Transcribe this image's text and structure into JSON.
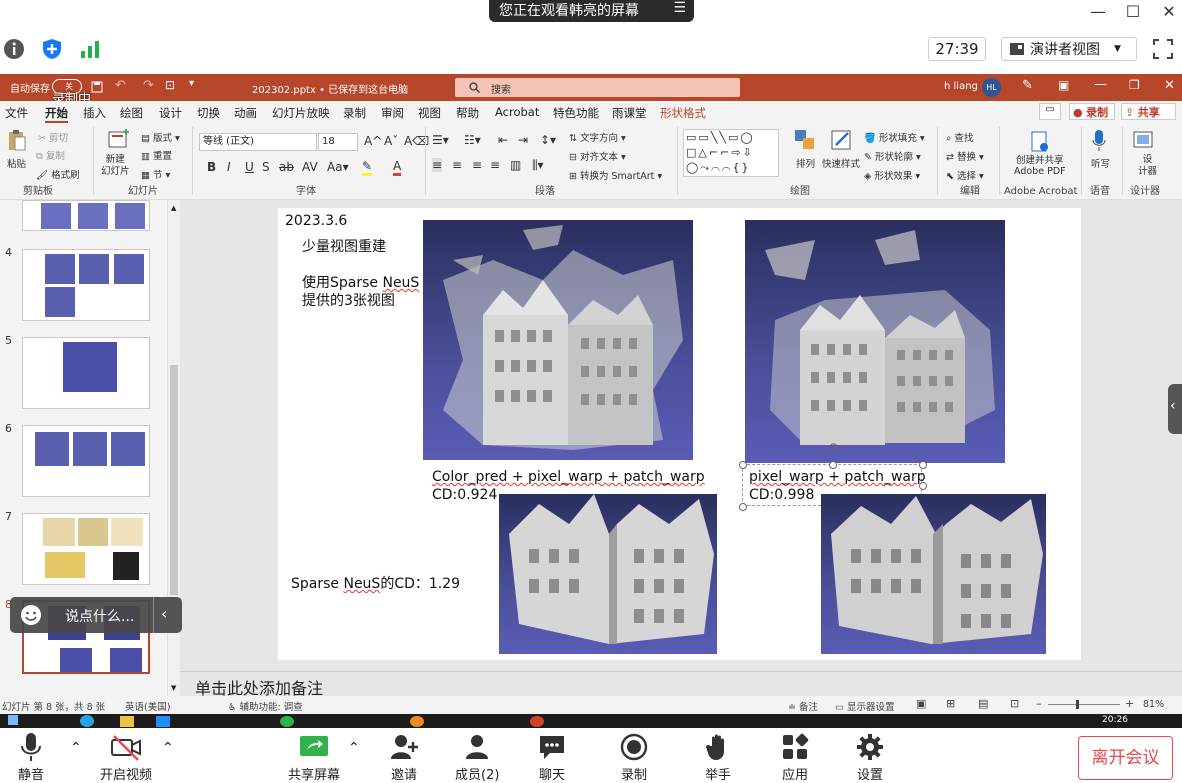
{
  "meeting": {
    "share_banner": "您正在观看韩亮的屏幕",
    "banner_menu": "☰",
    "timer": "27:39",
    "presenter_view": "演讲者视图",
    "dropdown_caret": "▼",
    "win_min": "—",
    "win_max": "☐",
    "win_close": "✕",
    "bottom": {
      "mute": "静音",
      "video": "开启视频",
      "share": "共享屏幕",
      "invite": "邀请",
      "members": "成员(2)",
      "chat": "聊天",
      "record": "录制",
      "raise_hand": "举手",
      "apps": "应用",
      "settings": "设置",
      "leave": "离开会议"
    },
    "chat_placeholder": "说点什么...",
    "accent": "#1677ff",
    "leave_color": "#e5484d"
  },
  "ppt": {
    "autosave": "自动保存",
    "autosave_state": "关",
    "recording_badge": "录制中",
    "file_title": "202302.pptx • 已保存到这台电脑",
    "search_placeholder": "搜索",
    "user": "h liang",
    "user_initials": "HL",
    "title_color": "#b7472a",
    "tabs": [
      "文件",
      "开始",
      "插入",
      "绘图",
      "设计",
      "切换",
      "动画",
      "幻灯片放映",
      "录制",
      "审阅",
      "视图",
      "帮助",
      "Acrobat",
      "特色功能",
      "雨课堂",
      "形状格式"
    ],
    "record_btn": "录制",
    "share_btn": "共享",
    "ribbon": {
      "paste": "粘贴",
      "cut": "剪切",
      "copy": "复制",
      "format_painter": "格式刷",
      "clipboard": "剪贴板",
      "new_slide": "新建\n幻灯片",
      "layout": "版式",
      "reset": "重置",
      "section": "节",
      "slides": "幻灯片",
      "font_name": "等线 (正文)",
      "font_size": "18",
      "font": "字体",
      "paragraph": "段落",
      "text_direction": "文字方向",
      "align_text": "对齐文本",
      "smartart": "转换为 SmartArt",
      "drawing": "绘图",
      "arrange": "排列",
      "quick_styles": "快速样式",
      "shape_fill": "形状填充",
      "shape_outline": "形状轮廓",
      "shape_effects": "形状效果",
      "find": "查找",
      "replace": "替换",
      "select": "选择",
      "editing": "编辑",
      "create_pdf": "创建并共享\nAdobe PDF",
      "adobe": "Adobe Acrobat",
      "dictate": "听写",
      "voice": "语音",
      "designer": "设\n计器",
      "designer_grp": "设计器"
    },
    "thumbnails": [
      "4",
      "5",
      "6",
      "7",
      "8"
    ],
    "slide": {
      "date": "2023.3.6",
      "heading": "少量视图重建",
      "desc_line1_a": "使用Sparse ",
      "desc_line1_b": "NeuS",
      "desc_line2": "提供的3张视图",
      "left_caption_line1": "Color_pred + pixel_warp + patch_warp",
      "left_caption_line2": "CD:0.924",
      "right_caption_line1": "pixel_warp + patch_warp",
      "right_caption_line2": "CD:0.998",
      "sparse_a": "Sparse ",
      "sparse_b": "NeuS",
      "sparse_c": "的CD：1.29"
    },
    "notes_placeholder": "单击此处添加备注",
    "status": {
      "slide_count": "幻灯片 第 8 张，共 8 张",
      "language": "英语(美国)",
      "accessibility": "辅助功能: 调查",
      "notes": "备注",
      "display_settings": "显示器设置",
      "zoom": "81%"
    }
  }
}
